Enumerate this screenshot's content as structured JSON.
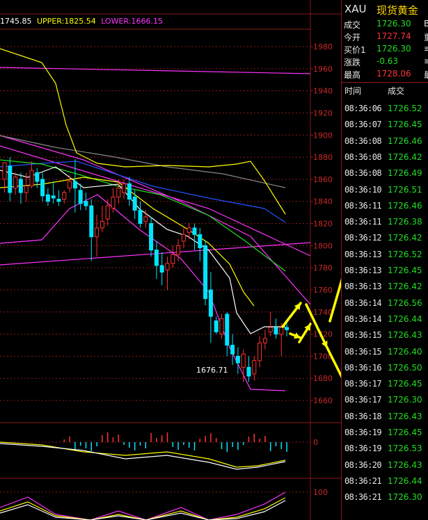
{
  "colors": {
    "up": "#ff3333",
    "down": "#00e5ff",
    "grid": "#8a1a1a",
    "axis_text": "#c82828",
    "yellow": "#ffff00",
    "magenta": "#ff33ff",
    "white": "#ffffff",
    "green": "#22dd22",
    "blue": "#2255ff",
    "arrow": "#ffff00"
  },
  "indicators": {
    "mid": "1745.85",
    "upper": "UPPER:1825.54",
    "lower": "LOWER:1666.15"
  },
  "price_axis": [
    "1980",
    "1960",
    "1940",
    "1920",
    "1900",
    "1880",
    "1860",
    "1840",
    "1820",
    "1800",
    "1780",
    "1760",
    "1740",
    "1720",
    "1700",
    "1680",
    "1660"
  ],
  "macd_axis_label": "0",
  "kdj_axis_label": "100",
  "low_label": "1676.71",
  "panel": {
    "symbol": "XAU",
    "name": "现货黄金",
    "quotes": [
      {
        "label": "成交",
        "value": "1726.30",
        "extra": "B",
        "color": "#22dd22"
      },
      {
        "label": "今开",
        "value": "1727.74",
        "extra": "重",
        "color": "#ff3333"
      },
      {
        "label": "买价1",
        "value": "1726.30",
        "extra": "≡",
        "color": "#22dd22"
      },
      {
        "label": "涨跌",
        "value": "-0.63",
        "extra": "≡",
        "color": "#22dd22"
      },
      {
        "label": "最高",
        "value": "1728.06",
        "extra": "最",
        "color": "#ff3333"
      }
    ],
    "header_time": "时间",
    "header_price": "成交",
    "ticks": [
      {
        "time": "08:36:06",
        "price": "1726.52"
      },
      {
        "time": "08:36:07",
        "price": "1726.45"
      },
      {
        "time": "08:36:08",
        "price": "1726.46"
      },
      {
        "time": "08:36:08",
        "price": "1726.42"
      },
      {
        "time": "08:36:08",
        "price": "1726.49"
      },
      {
        "time": "08:36:10",
        "price": "1726.51"
      },
      {
        "time": "08:36:11",
        "price": "1726.46"
      },
      {
        "time": "08:36:11",
        "price": "1726.38"
      },
      {
        "time": "08:36:12",
        "price": "1726.42"
      },
      {
        "time": "08:36:13",
        "price": "1726.52"
      },
      {
        "time": "08:36:13",
        "price": "1726.45"
      },
      {
        "time": "08:36:13",
        "price": "1726.42"
      },
      {
        "time": "08:36:14",
        "price": "1726.56"
      },
      {
        "time": "08:36:14",
        "price": "1726.44"
      },
      {
        "time": "08:36:15",
        "price": "1726.43"
      },
      {
        "time": "08:36:15",
        "price": "1726.40"
      },
      {
        "time": "08:36:16",
        "price": "1726.50"
      },
      {
        "time": "08:36:17",
        "price": "1726.45"
      },
      {
        "time": "08:36:17",
        "price": "1726.30"
      },
      {
        "time": "08:36:18",
        "price": "1726.43"
      },
      {
        "time": "08:36:19",
        "price": "1726.45"
      },
      {
        "time": "08:36:19",
        "price": "1726.53"
      },
      {
        "time": "08:36:20",
        "price": "1726.43"
      },
      {
        "time": "08:36:21",
        "price": "1726.44"
      },
      {
        "time": "08:36:21",
        "price": "1726.30"
      }
    ]
  },
  "chart_data": {
    "type": "candlestick",
    "y_axis": [
      1660,
      1980
    ],
    "candles": [
      {
        "o": 1860,
        "h": 1872,
        "c": 1875,
        "l": 1848
      },
      {
        "o": 1872,
        "h": 1880,
        "c": 1848,
        "l": 1840
      },
      {
        "o": 1852,
        "h": 1866,
        "c": 1862,
        "l": 1846
      },
      {
        "o": 1860,
        "h": 1866,
        "c": 1848,
        "l": 1838
      },
      {
        "o": 1848,
        "h": 1866,
        "c": 1854,
        "l": 1840
      },
      {
        "o": 1854,
        "h": 1876,
        "c": 1868,
        "l": 1852
      },
      {
        "o": 1866,
        "h": 1870,
        "c": 1858,
        "l": 1852
      },
      {
        "o": 1860,
        "h": 1866,
        "c": 1845,
        "l": 1840
      },
      {
        "o": 1846,
        "h": 1852,
        "c": 1840,
        "l": 1836
      },
      {
        "o": 1845,
        "h": 1858,
        "c": 1843,
        "l": 1838
      },
      {
        "o": 1842,
        "h": 1850,
        "c": 1840,
        "l": 1836
      },
      {
        "o": 1842,
        "h": 1850,
        "c": 1848,
        "l": 1838
      },
      {
        "o": 1852,
        "h": 1864,
        "c": 1858,
        "l": 1848
      },
      {
        "o": 1858,
        "h": 1878,
        "c": 1852,
        "l": 1830
      },
      {
        "o": 1850,
        "h": 1856,
        "c": 1838,
        "l": 1832
      },
      {
        "o": 1840,
        "h": 1848,
        "c": 1836,
        "l": 1832
      },
      {
        "o": 1836,
        "h": 1842,
        "c": 1808,
        "l": 1786
      },
      {
        "o": 1808,
        "h": 1828,
        "c": 1816,
        "l": 1790
      },
      {
        "o": 1816,
        "h": 1836,
        "c": 1822,
        "l": 1812
      },
      {
        "o": 1824,
        "h": 1842,
        "c": 1836,
        "l": 1818
      },
      {
        "o": 1834,
        "h": 1852,
        "c": 1844,
        "l": 1830
      },
      {
        "o": 1844,
        "h": 1860,
        "c": 1852,
        "l": 1838
      },
      {
        "o": 1848,
        "h": 1860,
        "c": 1856,
        "l": 1842
      },
      {
        "o": 1856,
        "h": 1862,
        "c": 1842,
        "l": 1836
      },
      {
        "o": 1844,
        "h": 1850,
        "c": 1832,
        "l": 1824
      },
      {
        "o": 1832,
        "h": 1840,
        "c": 1820,
        "l": 1816
      },
      {
        "o": 1822,
        "h": 1832,
        "c": 1826,
        "l": 1816
      },
      {
        "o": 1820,
        "h": 1826,
        "c": 1796,
        "l": 1790
      },
      {
        "o": 1796,
        "h": 1804,
        "c": 1782,
        "l": 1770
      },
      {
        "o": 1782,
        "h": 1794,
        "c": 1776,
        "l": 1764
      },
      {
        "o": 1778,
        "h": 1790,
        "c": 1784,
        "l": 1760
      },
      {
        "o": 1784,
        "h": 1800,
        "c": 1792,
        "l": 1780
      },
      {
        "o": 1792,
        "h": 1806,
        "c": 1800,
        "l": 1786
      },
      {
        "o": 1804,
        "h": 1816,
        "c": 1810,
        "l": 1798
      },
      {
        "o": 1812,
        "h": 1820,
        "c": 1816,
        "l": 1806
      },
      {
        "o": 1816,
        "h": 1820,
        "c": 1810,
        "l": 1796
      },
      {
        "o": 1810,
        "h": 1816,
        "c": 1798,
        "l": 1786
      },
      {
        "o": 1800,
        "h": 1804,
        "c": 1752,
        "l": 1746
      },
      {
        "o": 1760,
        "h": 1776,
        "c": 1736,
        "l": 1712
      },
      {
        "o": 1732,
        "h": 1736,
        "c": 1722,
        "l": 1720
      },
      {
        "o": 1720,
        "h": 1738,
        "c": 1734,
        "l": 1716
      },
      {
        "o": 1738,
        "h": 1740,
        "c": 1710,
        "l": 1700
      },
      {
        "o": 1710,
        "h": 1720,
        "c": 1702,
        "l": 1692
      },
      {
        "o": 1700,
        "h": 1708,
        "c": 1694,
        "l": 1684
      },
      {
        "o": 1690,
        "h": 1706,
        "c": 1702,
        "l": 1676.71
      },
      {
        "o": 1690,
        "h": 1700,
        "c": 1682,
        "l": 1676.71
      },
      {
        "o": 1684,
        "h": 1700,
        "c": 1696,
        "l": 1678
      },
      {
        "o": 1696,
        "h": 1718,
        "c": 1712,
        "l": 1690
      },
      {
        "o": 1712,
        "h": 1724,
        "c": 1716,
        "l": 1706
      },
      {
        "o": 1722,
        "h": 1740,
        "c": 1726,
        "l": 1718
      },
      {
        "o": 1726,
        "h": 1734,
        "c": 1720,
        "l": 1716
      },
      {
        "o": 1720,
        "h": 1730,
        "c": 1726,
        "l": 1700
      },
      {
        "o": 1726,
        "h": 1730,
        "c": 1724,
        "l": 1718
      }
    ]
  }
}
